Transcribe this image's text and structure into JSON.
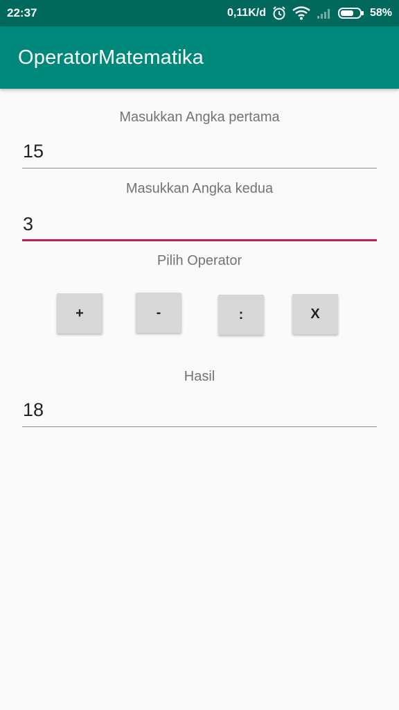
{
  "status_bar": {
    "time": "22:37",
    "network_speed": "0,11K/d",
    "battery": "58%",
    "icons": [
      "alarm-icon",
      "wifi-icon",
      "signal-icon",
      "battery-icon"
    ]
  },
  "app_bar": {
    "title": "OperatorMatematika"
  },
  "form": {
    "first_label": "Masukkan Angka pertama",
    "first_value": "15",
    "second_label": "Masukkan Angka kedua",
    "second_value": "3",
    "operator_label": "Pilih Operator",
    "operators": {
      "add": "+",
      "subtract": "-",
      "divide": ":",
      "multiply": "X"
    },
    "result_label": "Hasil",
    "result_value": "18"
  },
  "colors": {
    "status_bar": "#00695c",
    "app_bar": "#00897b",
    "accent": "#c2185b",
    "background": "#fafafa"
  }
}
